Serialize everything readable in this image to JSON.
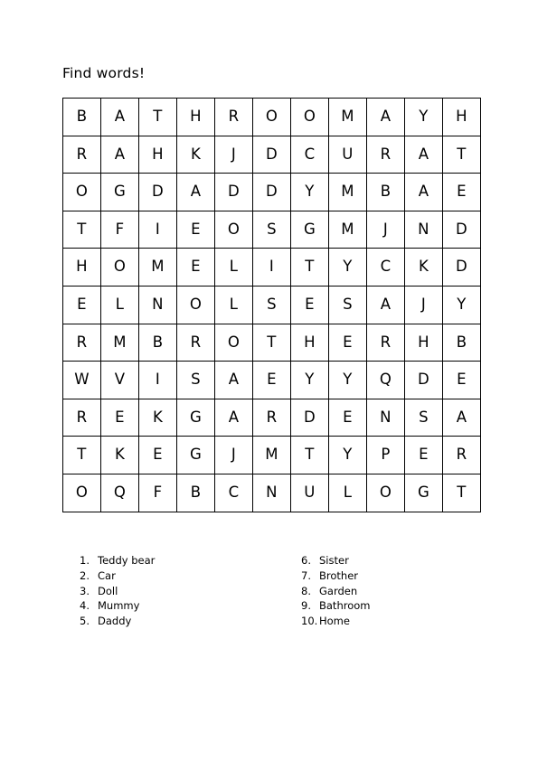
{
  "document": {
    "title": "Find words!"
  },
  "grid": {
    "rows": 11,
    "columns": 11,
    "letters": [
      [
        "B",
        "A",
        "T",
        "H",
        "R",
        "O",
        "O",
        "M",
        "A",
        "Y",
        "H"
      ],
      [
        "R",
        "A",
        "H",
        "K",
        "J",
        "D",
        "C",
        "U",
        "R",
        "A",
        "T"
      ],
      [
        "O",
        "G",
        "D",
        "A",
        "D",
        "D",
        "Y",
        "M",
        "B",
        "A",
        "E"
      ],
      [
        "T",
        "F",
        "I",
        "E",
        "O",
        "S",
        "G",
        "M",
        "J",
        "N",
        "D"
      ],
      [
        "H",
        "O",
        "M",
        "E",
        "L",
        "I",
        "T",
        "Y",
        "C",
        "K",
        "D"
      ],
      [
        "E",
        "L",
        "N",
        "O",
        "L",
        "S",
        "E",
        "S",
        "A",
        "J",
        "Y"
      ],
      [
        "R",
        "M",
        "B",
        "R",
        "O",
        "T",
        "H",
        "E",
        "R",
        "H",
        "B"
      ],
      [
        "W",
        "V",
        "I",
        "S",
        "A",
        "E",
        "Y",
        "Y",
        "Q",
        "D",
        "E"
      ],
      [
        "R",
        "E",
        "K",
        "G",
        "A",
        "R",
        "D",
        "E",
        "N",
        "S",
        "A"
      ],
      [
        "T",
        "K",
        "E",
        "G",
        "J",
        "M",
        "T",
        "Y",
        "P",
        "E",
        "R"
      ],
      [
        "O",
        "Q",
        "F",
        "B",
        "C",
        "N",
        "U",
        "L",
        "O",
        "G",
        "T"
      ]
    ]
  },
  "word_list": {
    "left_column": [
      {
        "number": "1.",
        "word": "Teddy bear"
      },
      {
        "number": "2.",
        "word": "Car"
      },
      {
        "number": "3.",
        "word": "Doll"
      },
      {
        "number": "4.",
        "word": "Mummy"
      },
      {
        "number": "5.",
        "word": "Daddy"
      }
    ],
    "right_column": [
      {
        "number": "6.",
        "word": "Sister"
      },
      {
        "number": "7.",
        "word": "Brother"
      },
      {
        "number": "8.",
        "word": "Garden"
      },
      {
        "number": "9.",
        "word": "Bathroom"
      },
      {
        "number": "10.",
        "word": "Home"
      }
    ]
  },
  "colors": {
    "text": "#000000",
    "grid_line": "#000000",
    "background": "#ffffff"
  }
}
